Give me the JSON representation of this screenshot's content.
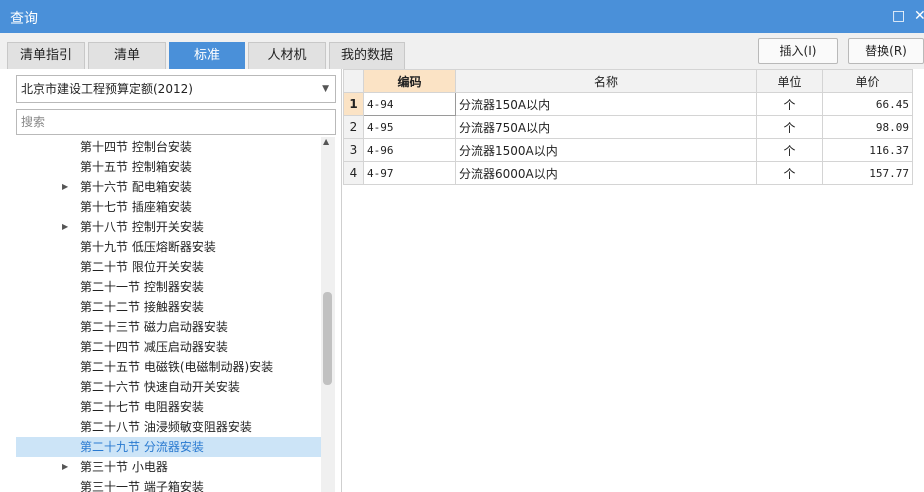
{
  "window": {
    "title": "查询",
    "restore_glyph": "□",
    "close_glyph": "✕"
  },
  "tabs": [
    "清单指引",
    "清单",
    "标准",
    "人材机",
    "我的数据"
  ],
  "active_tab": "标准",
  "toolbar": {
    "insert_label": "插入(I)",
    "replace_label": "替换(R)"
  },
  "left": {
    "quota_select": "北京市建设工程预算定额(2012)",
    "search_placeholder": "搜索",
    "tree": [
      {
        "label": "第十四节 控制台安装",
        "expandable": false,
        "selected": false
      },
      {
        "label": "第十五节 控制箱安装",
        "expandable": false,
        "selected": false
      },
      {
        "label": "第十六节 配电箱安装",
        "expandable": true,
        "selected": false
      },
      {
        "label": "第十七节 插座箱安装",
        "expandable": false,
        "selected": false
      },
      {
        "label": "第十八节 控制开关安装",
        "expandable": true,
        "selected": false
      },
      {
        "label": "第十九节 低压熔断器安装",
        "expandable": false,
        "selected": false
      },
      {
        "label": "第二十节 限位开关安装",
        "expandable": false,
        "selected": false
      },
      {
        "label": "第二十一节 控制器安装",
        "expandable": false,
        "selected": false
      },
      {
        "label": "第二十二节 接触器安装",
        "expandable": false,
        "selected": false
      },
      {
        "label": "第二十三节 磁力启动器安装",
        "expandable": false,
        "selected": false
      },
      {
        "label": "第二十四节 减压启动器安装",
        "expandable": false,
        "selected": false
      },
      {
        "label": "第二十五节 电磁铁(电磁制动器)安装",
        "expandable": false,
        "selected": false
      },
      {
        "label": "第二十六节 快速自动开关安装",
        "expandable": false,
        "selected": false
      },
      {
        "label": "第二十七节 电阻器安装",
        "expandable": false,
        "selected": false
      },
      {
        "label": "第二十八节 油浸频敏变阻器安装",
        "expandable": false,
        "selected": false
      },
      {
        "label": "第二十九节 分流器安装",
        "expandable": false,
        "selected": true
      },
      {
        "label": "第三十节 小电器",
        "expandable": true,
        "selected": false
      },
      {
        "label": "第三十一节 端子箱安装",
        "expandable": false,
        "selected": false
      }
    ]
  },
  "grid": {
    "headers": {
      "code": "编码",
      "name": "名称",
      "unit": "单位",
      "price": "单价"
    },
    "rows": [
      {
        "num": "1",
        "code": "4-94",
        "name": "分流器150A以内",
        "unit": "个",
        "price": "66.45"
      },
      {
        "num": "2",
        "code": "4-95",
        "name": "分流器750A以内",
        "unit": "个",
        "price": "98.09"
      },
      {
        "num": "3",
        "code": "4-96",
        "name": "分流器1500A以内",
        "unit": "个",
        "price": "116.37"
      },
      {
        "num": "4",
        "code": "4-97",
        "name": "分流器6000A以内",
        "unit": "个",
        "price": "157.77"
      }
    ]
  }
}
